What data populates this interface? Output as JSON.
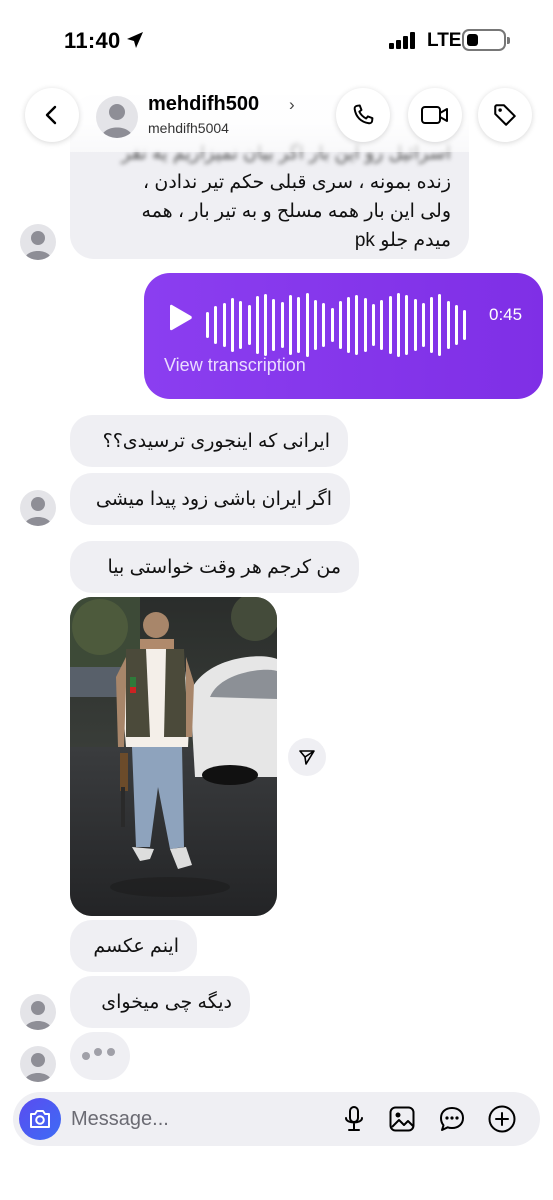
{
  "status_bar": {
    "time": "11:40",
    "network": "LTE"
  },
  "header": {
    "username": "mehdifh500",
    "handle": "mehdifh5004"
  },
  "messages": {
    "long_text_lines": [
      "اسرائیل رو این بار اگر بیان نمیزاریم یه نفر",
      "زنده بمونه ، سری قبلی حکم تیر ندادن ،",
      "ولی این بار همه مسلح و به تیر بار ، همه",
      "میدم جلو pk"
    ],
    "voice": {
      "duration": "0:45",
      "transcription_link": "View transcription"
    },
    "texts": [
      "ایرانی که اینجوری ترسیدی؟؟",
      "اگر ایران باشی زود پیدا میشی",
      "من کرجم هر وقت خواستی بیا",
      "اینم عکسم",
      "دیگه چی میخوای"
    ]
  },
  "composer": {
    "placeholder": "Message..."
  },
  "colors": {
    "voice_bubble": "#8b3ef0",
    "bubble_gray": "#efeff3",
    "camera_button": "#4a5ef2"
  },
  "icons": {
    "back": "chevron-left-icon",
    "call": "phone-icon",
    "video": "video-camera-icon",
    "tag": "tag-icon",
    "play": "play-icon",
    "share": "send-icon",
    "camera": "camera-icon",
    "mic": "microphone-icon",
    "gallery": "image-icon",
    "sticker": "chat-bubble-icon",
    "more": "plus-circle-icon"
  }
}
